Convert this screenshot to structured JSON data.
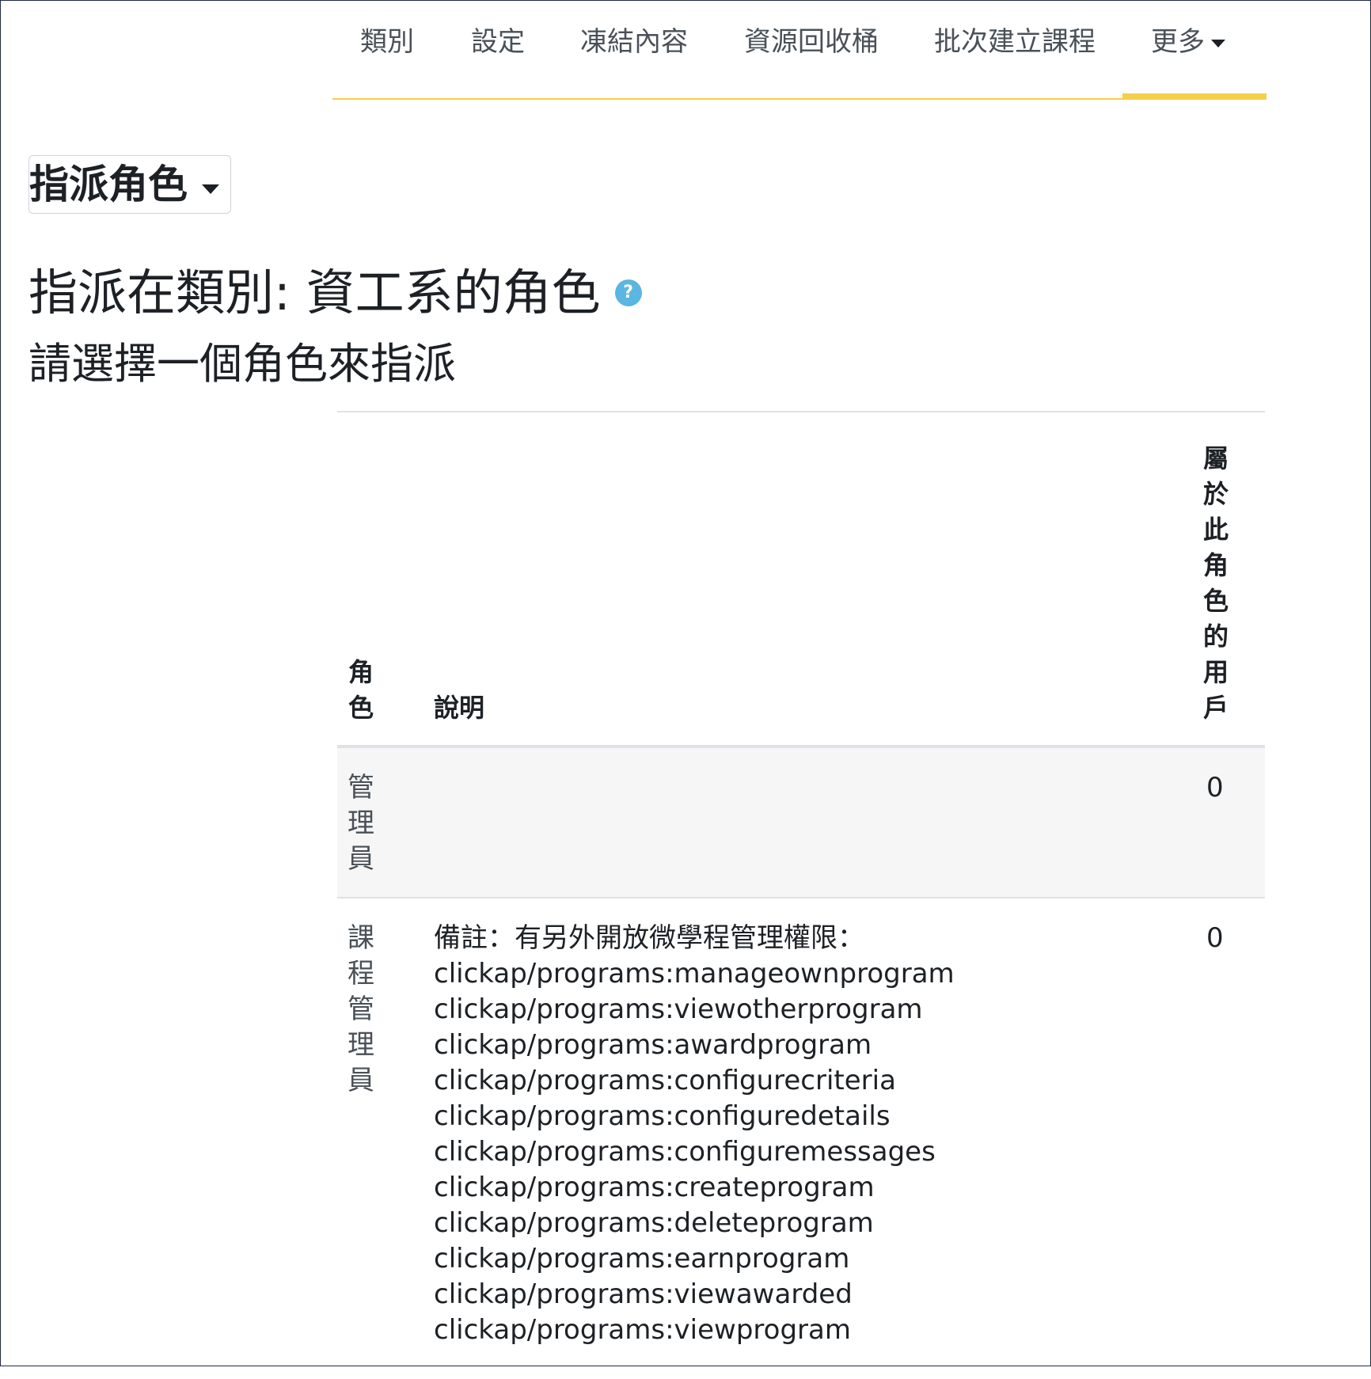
{
  "nav": {
    "items": [
      "類別",
      "設定",
      "凍結內容",
      "資源回收桶",
      "批次建立課程"
    ],
    "more_label": "更多"
  },
  "selector": {
    "label": "指派角色"
  },
  "page_title": "指派在類別: 資工系的角色",
  "subtitle": "請選擇一個角色來指派",
  "table": {
    "headers": {
      "role": "角色",
      "description": "說明",
      "users": "屬於此角色的用戶"
    },
    "rows": [
      {
        "role": "管理員",
        "description": [],
        "users": "0"
      },
      {
        "role": "課程管理員",
        "description": [
          "備註：有另外開放微學程管理權限：",
          "clickap/programs:manageownprogram",
          "clickap/programs:viewotherprogram",
          "clickap/programs:awardprogram",
          "clickap/programs:configurecriteria",
          "clickap/programs:configuredetails",
          "clickap/programs:configuremessages",
          "clickap/programs:createprogram",
          "clickap/programs:deleteprogram",
          "clickap/programs:earnprogram",
          "clickap/programs:viewawarded",
          "clickap/programs:viewprogram"
        ],
        "users": "0"
      }
    ]
  },
  "colors": {
    "accent": "#f3cf4a",
    "help": "#5bb6e0"
  },
  "icons": {
    "help": "question-icon",
    "caret": "caret-down-icon"
  }
}
